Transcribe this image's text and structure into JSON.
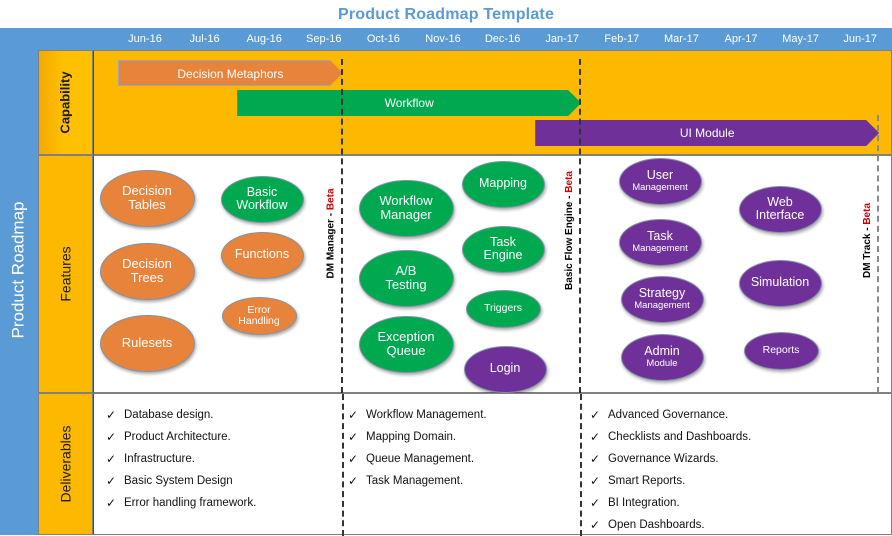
{
  "title": "Product Roadmap Template",
  "side_label": "Product Roadmap",
  "colors": {
    "accent_blue": "#5B9BD5",
    "header_yellow": "#FCB900",
    "orange": "#E8833C",
    "green": "#00A94F",
    "purple": "#70309A",
    "beta_red": "#CC0000"
  },
  "timeline": {
    "months": [
      "Jun-16",
      "Jul-16",
      "Aug-16",
      "Sep-16",
      "Oct-16",
      "Nov-16",
      "Dec-16",
      "Jan-17",
      "Feb-17",
      "Mar-17",
      "Apr-17",
      "May-17",
      "Jun-17"
    ]
  },
  "rows": {
    "capability": "Capability",
    "features": "Features",
    "deliverables": "Deliverables"
  },
  "capability_bars": [
    {
      "label": "Decision Metaphors",
      "color": "orange",
      "start_month": "Jun-16",
      "end_month": "Sep-16"
    },
    {
      "label": "Workflow",
      "color": "green",
      "start_month": "Aug-16",
      "end_month": "Jan-17"
    },
    {
      "label": "UI Module",
      "color": "purple",
      "start_month": "Jan-17",
      "end_month": "Jun-17"
    }
  ],
  "milestones": [
    {
      "label_prefix": "DM Manager - ",
      "label_beta": "Beta",
      "at_month": "Sep-16"
    },
    {
      "label_prefix": "Basic Flow Engine - ",
      "label_beta": "Beta",
      "at_month": "Jan-17"
    },
    {
      "label_prefix": "DM Track - ",
      "label_beta": "Beta",
      "at_month": "Jun-17"
    }
  ],
  "features": {
    "phase1": [
      {
        "line1": "Decision",
        "line2": "Tables",
        "color": "orange",
        "size": "lg"
      },
      {
        "line1": "Decision",
        "line2": "Trees",
        "color": "orange",
        "size": "lg"
      },
      {
        "line1": "Rulesets",
        "line2": "",
        "color": "orange",
        "size": "lg"
      },
      {
        "line1": "Basic",
        "line2": "Workflow",
        "color": "green",
        "size": "md"
      },
      {
        "line1": "Functions",
        "line2": "",
        "color": "orange",
        "size": "md"
      },
      {
        "line1": "Error",
        "line2": "Handling",
        "color": "orange",
        "size": "sm"
      }
    ],
    "phase2": [
      {
        "line1": "Workflow",
        "line2": "Manager",
        "color": "green",
        "size": "lg"
      },
      {
        "line1": "A/B",
        "line2": "Testing",
        "color": "green",
        "size": "lg"
      },
      {
        "line1": "Exception",
        "line2": "Queue",
        "color": "green",
        "size": "lg"
      },
      {
        "line1": "Mapping",
        "line2": "",
        "color": "green",
        "size": "md"
      },
      {
        "line1": "Task",
        "line2": "Engine",
        "color": "green",
        "size": "md"
      },
      {
        "line1": "Triggers",
        "line2": "",
        "color": "green",
        "size": "sm"
      },
      {
        "line1": "Login",
        "line2": "",
        "color": "purple",
        "size": "md"
      }
    ],
    "phase3": [
      {
        "line1": "User",
        "line2": "Management",
        "color": "purple",
        "size": "md"
      },
      {
        "line1": "Task",
        "line2": "Management",
        "color": "purple",
        "size": "md"
      },
      {
        "line1": "Strategy",
        "line2": "Management",
        "color": "purple",
        "size": "md"
      },
      {
        "line1": "Admin",
        "line2": "Module",
        "color": "purple",
        "size": "md"
      },
      {
        "line1": "Web",
        "line2": "Interface",
        "color": "purple",
        "size": "md"
      },
      {
        "line1": "Simulation",
        "line2": "",
        "color": "purple",
        "size": "md"
      },
      {
        "line1": "Reports",
        "line2": "",
        "color": "purple",
        "size": "sm"
      }
    ]
  },
  "deliverables": {
    "check_glyph": "✓",
    "phase1": [
      "Database design.",
      "Product Architecture.",
      "Infrastructure.",
      "Basic System Design",
      "Error handling framework."
    ],
    "phase2": [
      "Workflow Management.",
      "Mapping Domain.",
      "Queue Management.",
      "Task Management."
    ],
    "phase3": [
      "Advanced Governance.",
      "Checklists and Dashboards.",
      "Governance Wizards.",
      "Smart Reports.",
      "BI Integration.",
      "Open Dashboards."
    ]
  }
}
